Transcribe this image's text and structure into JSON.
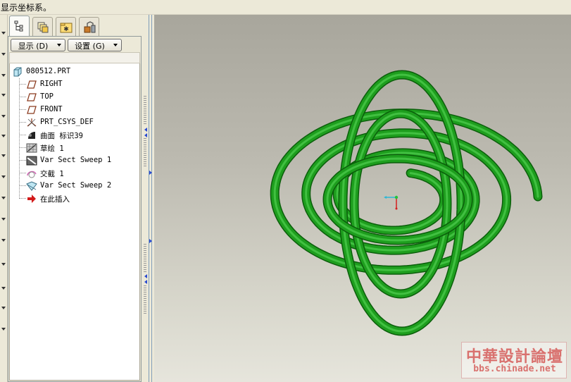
{
  "message_bar": {
    "text": "显示坐标系。"
  },
  "panel": {
    "tabs": [
      {
        "icon": "model-tree-icon",
        "active": true
      },
      {
        "icon": "layers-icon",
        "active": false
      },
      {
        "icon": "favorites-folder-icon",
        "active": false
      },
      {
        "icon": "tools-icon",
        "active": false
      }
    ],
    "show_button": "显示 (D)",
    "settings_button": "设置 (G)"
  },
  "tree": {
    "root": {
      "label": "080512.PRT",
      "icon": "part-icon"
    },
    "items": [
      {
        "label": "RIGHT",
        "icon": "datum-plane-icon"
      },
      {
        "label": "TOP",
        "icon": "datum-plane-icon"
      },
      {
        "label": "FRONT",
        "icon": "datum-plane-icon"
      },
      {
        "label": "PRT_CSYS_DEF",
        "icon": "coordinate-system-icon"
      },
      {
        "label": "曲面 标识39",
        "icon": "surface-icon"
      },
      {
        "label": "草绘 1",
        "icon": "sketch-icon"
      },
      {
        "label": "Var Sect Sweep 1",
        "icon": "var-sect-sweep-icon"
      },
      {
        "label": "交截 1",
        "icon": "intersect-icon"
      },
      {
        "label": "Var Sect Sweep 2",
        "icon": "var-sect-sweep-icon"
      },
      {
        "label": "在此插入",
        "icon": "insert-here-arrow-icon"
      }
    ]
  },
  "viewport": {
    "model_color": "#1e9e1e",
    "model_highlight": "#5fdc5f",
    "model_shadow": "#0b5e0b",
    "csys_x_color": "#2db7d6",
    "csys_y_color": "#22c43a",
    "csys_z_color": "#d41f1f"
  },
  "watermark": {
    "title": "中華設計論壇",
    "url": "bbs.chinade.net"
  }
}
